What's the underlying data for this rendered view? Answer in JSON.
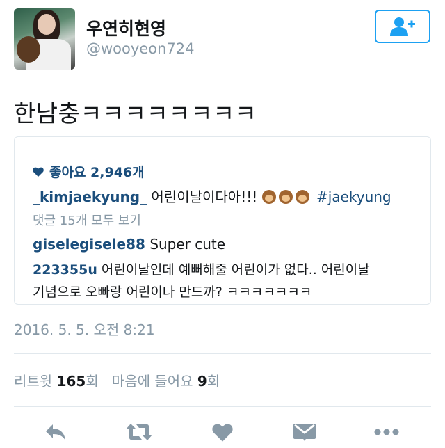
{
  "user": {
    "display_name": "우연히현영",
    "handle": "@wooyeon724"
  },
  "tweet": {
    "text": "한남충ㅋㅋㅋㅋㅋㅋㅋㅋ"
  },
  "quote": {
    "likes": "좋아요 2,946개",
    "caption_user": "_kimjaekyung_",
    "caption_text": "어린이날이다아!!!",
    "caption_tag": "#jaekyung",
    "view_comments": "댓글 15개 모두 보기",
    "comments": [
      {
        "user": "giselegisele88",
        "text": "Super cute"
      },
      {
        "user": "223355u",
        "text": "어린이날인데 예뻐해줄 어린이가 없다.. 어린이날",
        "text2": "기념으로 오빠랑 어린이나 만드까? ㅋㅋㅋㅋㅋㅋㅋ"
      }
    ]
  },
  "timestamp": "2016. 5. 5. 오전 8:21",
  "stats": {
    "retweets_label": "리트윗",
    "retweets_count": "165",
    "retweets_unit": "회",
    "likes_label": "마음에 들어요",
    "likes_count": "9",
    "likes_unit": "회"
  },
  "icons": {
    "follow": "add-user-icon",
    "reply": "reply-icon",
    "retweet": "retweet-icon",
    "like": "heart-icon",
    "dm": "envelope-icon",
    "more": "more-icon"
  },
  "colors": {
    "accent": "#1da1f2",
    "icon_gray": "#8899a6",
    "link": "#1b4e7c"
  }
}
